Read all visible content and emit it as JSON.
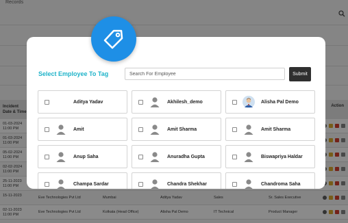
{
  "background": {
    "section_title": "Records",
    "table_headers": {
      "date": "Incident Date & Time",
      "action": "Action"
    },
    "rows": [
      {
        "date": "01-03-2024",
        "time": "11:00 PM"
      },
      {
        "date": "01-03-2024",
        "time": "11:00 PM"
      },
      {
        "date": "05-02-2024",
        "time": "11:00 PM"
      },
      {
        "date": "02-02-2024",
        "time": "11:00 PM"
      },
      {
        "date": "25-11-2023",
        "time": "11:00 PM"
      },
      {
        "date": "15-11-2023",
        "time": "",
        "company": "Eve Technologies Pvt Ltd",
        "location": "Mumbai",
        "person": "Aditya Yadav",
        "dept": "Sales",
        "role": "Sr. Sales Executive"
      },
      {
        "date": "02-11-2023",
        "time": "11:00 PM",
        "company": "Eve Technologies Pvt Ltd",
        "location": "Kolkata (Head Office)",
        "person": "Alisha Pal Demo",
        "dept": "IT Technical",
        "role": "Product Manager"
      }
    ]
  },
  "modal": {
    "title": "Select Employee To Tag",
    "search_placeholder": "Search For Employee",
    "submit_label": "Submit",
    "badge_icon": "tag-icon",
    "employees": [
      {
        "name": "Aditya Yadav",
        "avatar": "none",
        "checked": false
      },
      {
        "name": "Akhilesh_demo",
        "avatar": "placeholder",
        "checked": false
      },
      {
        "name": "Alisha Pal Demo",
        "avatar": "photo",
        "checked": false
      },
      {
        "name": "Amit",
        "avatar": "placeholder",
        "checked": false
      },
      {
        "name": "Amit Sharma",
        "avatar": "placeholder",
        "checked": false
      },
      {
        "name": "Amit Sharma",
        "avatar": "placeholder",
        "checked": false
      },
      {
        "name": "Anup Saha",
        "avatar": "placeholder",
        "checked": false
      },
      {
        "name": "Anuradha Gupta",
        "avatar": "placeholder",
        "checked": false
      },
      {
        "name": "Biswapriya Haldar",
        "avatar": "placeholder",
        "checked": false
      },
      {
        "name": "Champa Sardar",
        "avatar": "placeholder",
        "checked": false
      },
      {
        "name": "Chandra Shekhar",
        "avatar": "placeholder",
        "checked": false
      },
      {
        "name": "Chandroma Saha",
        "avatar": "placeholder",
        "checked": false
      }
    ]
  },
  "colors": {
    "accent_title": "#1fb3c9",
    "badge": "#1e8fe6",
    "submit_bg": "#2f2f2f"
  }
}
